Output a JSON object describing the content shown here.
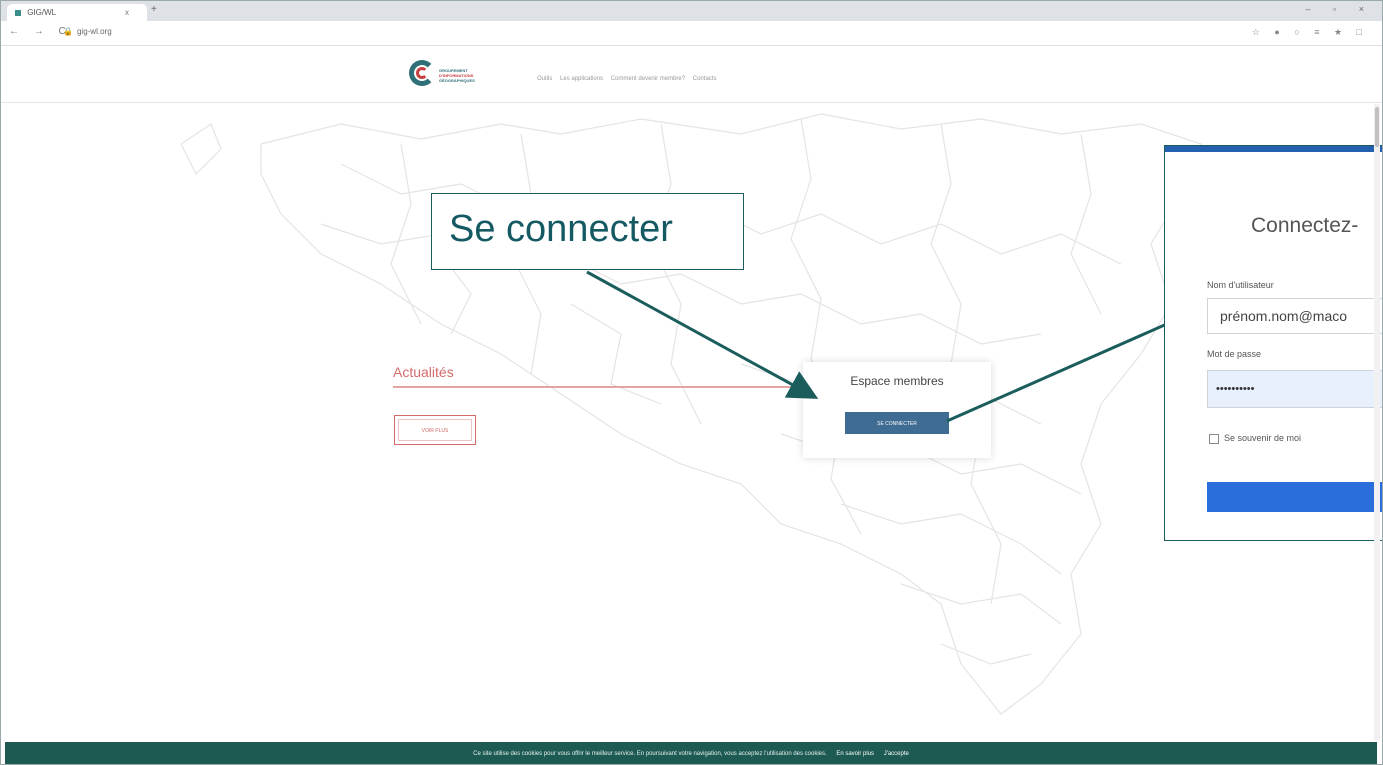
{
  "browser": {
    "tab_title": "GIG/WL",
    "tab_close": "x",
    "new_tab": "+",
    "window_controls": "– ▫ ×",
    "nav_buttons": "← → C",
    "url": "gig-wl.org",
    "extensions": "☆ ● ○ ≡ ★ □"
  },
  "site": {
    "logo_line1": "GROUPEMENT",
    "logo_line2": "D'INFORMATIONS",
    "logo_line3": "GÉOGRAPHIQUES",
    "menu": [
      "Outils",
      "Les applications",
      "Comment devenir membre?",
      "Contacts"
    ]
  },
  "main": {
    "actualites_title": "Actualités",
    "voir_plus": "VOIR PLUS",
    "espace_title": "Espace membres",
    "connect_button": "SE CONNECTER"
  },
  "annotation": {
    "callout_text": "Se connecter",
    "color": "#155a63"
  },
  "login_zoom": {
    "title": "Connectez-",
    "user_label": "Nom d'utilisateur",
    "user_value": "prénom.nom@maco",
    "password_label": "Mot de passe",
    "password_value": "••••••••••",
    "remember_label": "Se souvenir de moi",
    "accent": "#2460b0"
  },
  "cookie_bar": {
    "text": "Ce site utilise des cookies pour vous offrir le meilleur service. En poursuivant votre navigation, vous acceptez l'utilisation des cookies.",
    "more_link": "En savoir plus",
    "accept_link": "J'accepte"
  }
}
